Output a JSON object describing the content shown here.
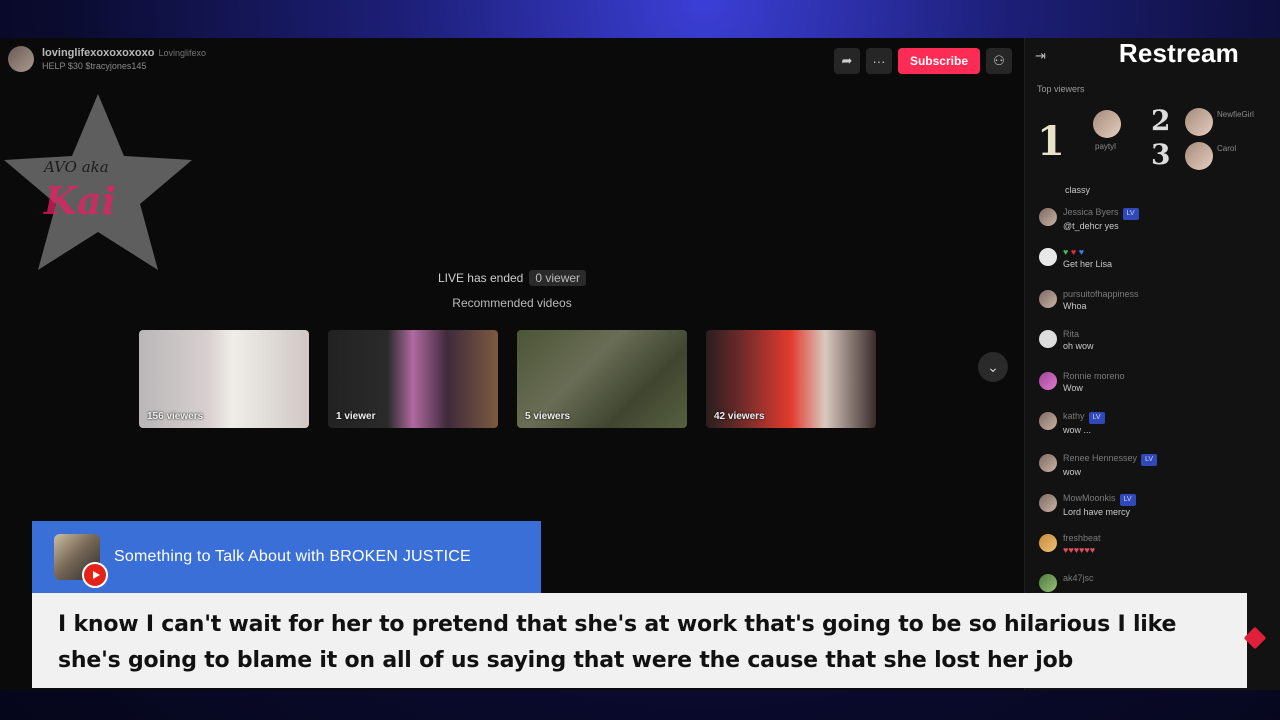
{
  "brand": "Restream",
  "host": {
    "name": "lovinglifexoxoxoxoxo",
    "handle": "Lovinglifexo",
    "subtitle": "HELP $30 $tracyjones145"
  },
  "watermark": {
    "line1": "AVO aka",
    "line2": "Kai"
  },
  "actions": {
    "share_icon": "share-icon",
    "more": "···",
    "subscribe": "Subscribe",
    "add_user_icon": "add-user-icon"
  },
  "status": {
    "ended": "LIVE has ended",
    "viewer_count": "0 viewer",
    "recommended": "Recommended videos"
  },
  "recommended": [
    {
      "viewers": "156 viewers"
    },
    {
      "viewers": "1 viewer"
    },
    {
      "viewers": "5 viewers"
    },
    {
      "viewers": "42 viewers"
    }
  ],
  "chat": {
    "collapse": "⇥",
    "top_viewers_title": "Top viewers",
    "ranks": [
      "1",
      "2",
      "3"
    ],
    "top_viewers": [
      {
        "name": "paytyl"
      },
      {
        "name": "NewfieGirl"
      },
      {
        "name": "Carol"
      }
    ],
    "messages": [
      {
        "user": "",
        "text": "classy"
      },
      {
        "user": "Jessica Byers",
        "badge": "LV",
        "text": "@t_dehcr yes"
      },
      {
        "user": "",
        "text": "Get her Lisa"
      },
      {
        "user": "pursuitofhappiness",
        "text": "Whoa"
      },
      {
        "user": "Rita",
        "text": "oh wow"
      },
      {
        "user": "Ronnie moreno",
        "text": "Wow"
      },
      {
        "user": "kathy",
        "badge": "LV",
        "text": "wow ..."
      },
      {
        "user": "Renee Hennessey",
        "badge": "LV",
        "text": "wow"
      },
      {
        "user": "MowMoonkis",
        "badge": "LV",
        "text": "Lord have mercy"
      },
      {
        "user": "freshbeat",
        "text": "♥♥♥♥♥♥"
      },
      {
        "user": "ak47jsc",
        "text": ""
      }
    ]
  },
  "source": {
    "title": "Something to Talk About with BROKEN JUSTICE",
    "platform_icon": "youtube-icon"
  },
  "caption": {
    "text": "I know I can't wait for her to pretend that she's at work that's going to be so hilarious I like she's going to blame it on all of us saying that were the cause that she lost her job"
  }
}
